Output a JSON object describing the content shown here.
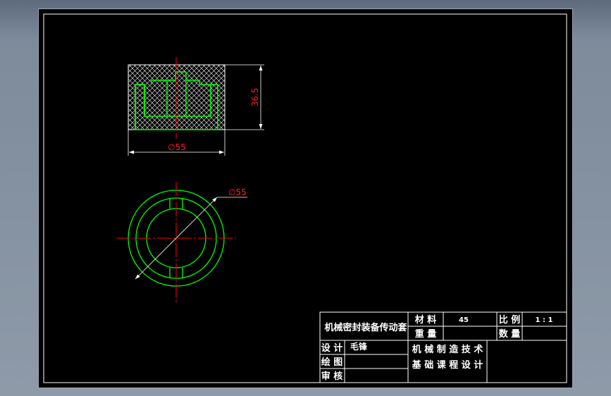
{
  "drawing": {
    "dimensions": {
      "front_width": "∅55",
      "front_height": "36.5",
      "top_diameter": "∅55"
    },
    "title_block": {
      "part_name": "机械密封装备传动套",
      "material_label": "材 料",
      "material_value": "45",
      "scale_label": "比 例",
      "scale_value": "1 : 1",
      "weight_label": "重 量",
      "quantity_label": "数 量",
      "designer_label": "设 计",
      "designer_name": "毛锋",
      "drafter_label": "绘 图",
      "checker_label": "审 核",
      "school_line1": "机 械 制 造 技 术",
      "school_line2": "基 础 课 程 设 计"
    }
  },
  "colors": {
    "background": "#000000",
    "outline": "#ffffff",
    "inner_part": "#00ff00",
    "centerline": "#ff0000",
    "dimension_text": "#ff2020"
  }
}
